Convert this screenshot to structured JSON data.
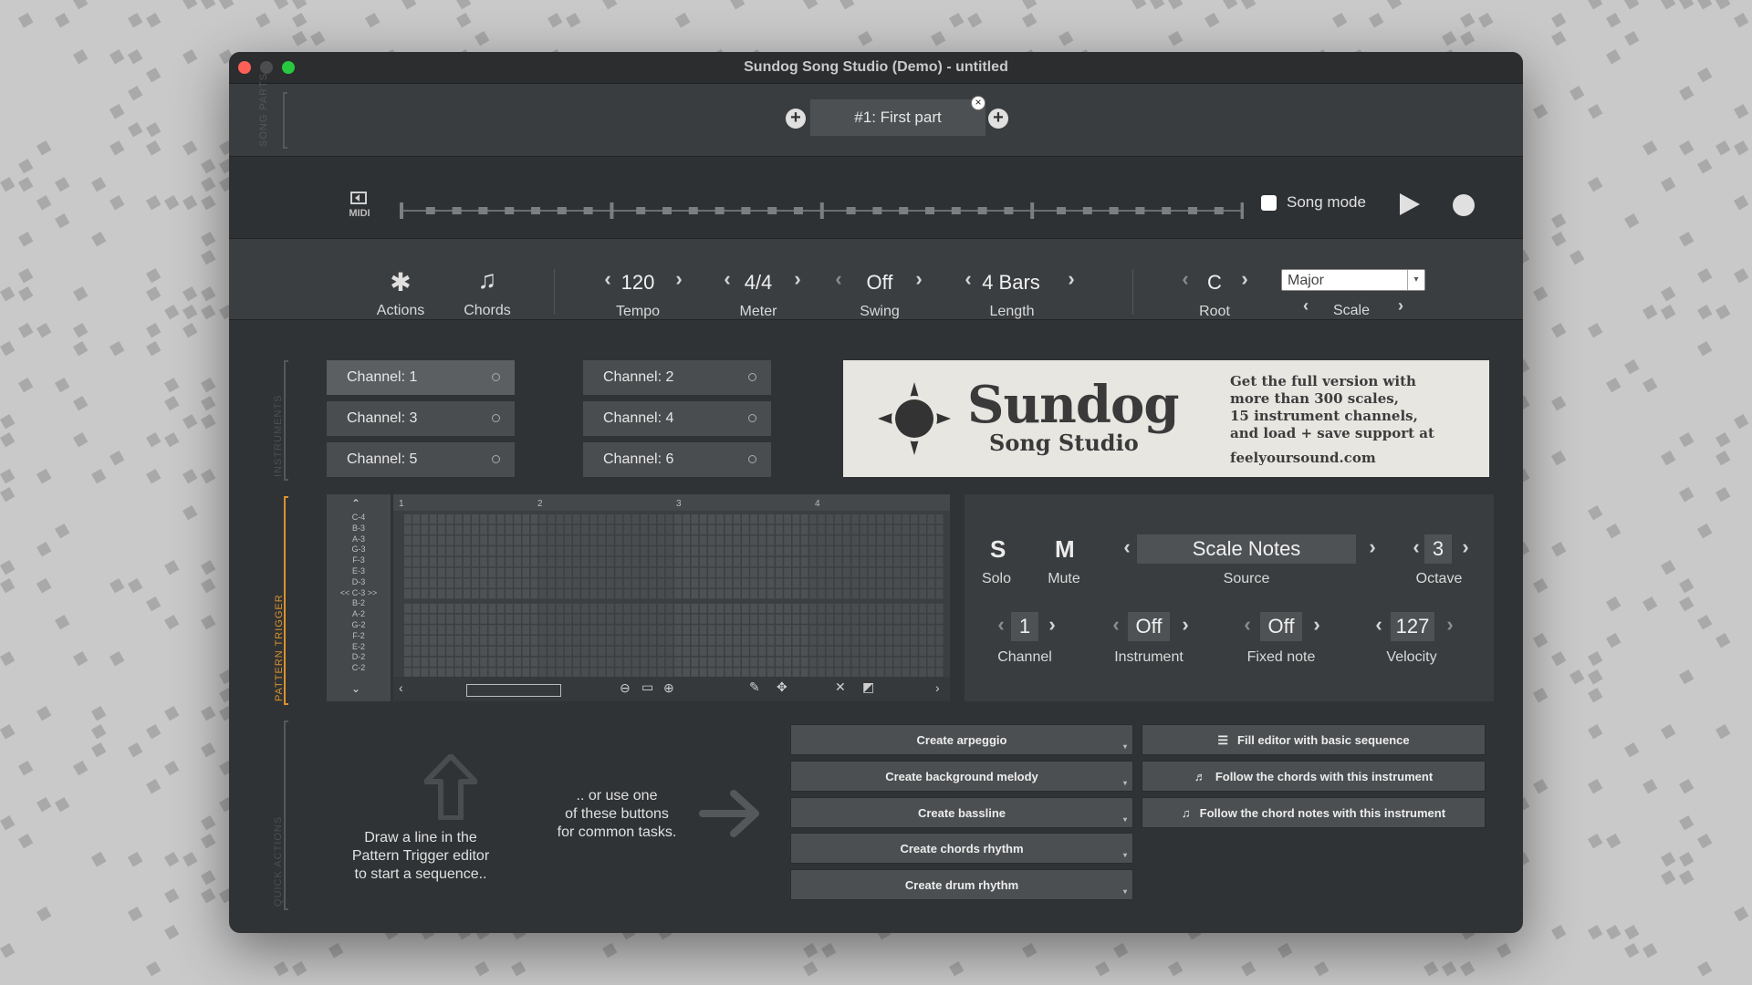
{
  "window": {
    "title": "Sundog Song Studio (Demo) - untitled"
  },
  "song_parts": {
    "section_label": "SONG PARTS",
    "tabs": [
      {
        "label": "#1: First part"
      }
    ]
  },
  "transport": {
    "midi_label": "MIDI",
    "song_mode_label": "Song mode",
    "song_mode_checked": false
  },
  "toolbar": {
    "actions_label": "Actions",
    "chords_label": "Chords",
    "tempo": {
      "value": "120",
      "label": "Tempo"
    },
    "meter": {
      "value": "4/4",
      "label": "Meter"
    },
    "swing": {
      "value": "Off",
      "label": "Swing"
    },
    "length": {
      "value": "4 Bars",
      "label": "Length"
    },
    "root": {
      "value": "C",
      "label": "Root"
    },
    "scale": {
      "selected": "Major",
      "label": "Scale"
    }
  },
  "instruments": {
    "section_label": "INSTRUMENTS",
    "channels": [
      {
        "label": "Channel: 1",
        "active": true
      },
      {
        "label": "Channel: 2",
        "active": false
      },
      {
        "label": "Channel: 3",
        "active": false
      },
      {
        "label": "Channel: 4",
        "active": false
      },
      {
        "label": "Channel: 5",
        "active": false
      },
      {
        "label": "Channel: 6",
        "active": false
      }
    ]
  },
  "ad": {
    "brand": "Sundog",
    "subbrand": "Song Studio",
    "text_lines": [
      "Get the full version with",
      "more than 300 scales,",
      "15 instrument channels,",
      "and load + save support at"
    ],
    "url": "feelyoursound.com"
  },
  "pattern_trigger": {
    "section_label": "PATTERN TRIGGER",
    "note_labels": [
      "C-4",
      "B-3",
      "A-3",
      "G-3",
      "F-3",
      "E-3",
      "D-3",
      "<< C-3 >>",
      "B-2",
      "A-2",
      "G-2",
      "F-2",
      "E-2",
      "D-2",
      "C-2"
    ],
    "bar_numbers": [
      "1",
      "2",
      "3",
      "4"
    ]
  },
  "track": {
    "solo": {
      "letter": "S",
      "label": "Solo"
    },
    "mute": {
      "letter": "M",
      "label": "Mute"
    },
    "source": {
      "value": "Scale Notes",
      "label": "Source"
    },
    "octave": {
      "value": "3",
      "label": "Octave"
    },
    "channel": {
      "value": "1",
      "label": "Channel"
    },
    "instrument": {
      "value": "Off",
      "label": "Instrument"
    },
    "fixed_note": {
      "value": "Off",
      "label": "Fixed note"
    },
    "velocity": {
      "value": "127",
      "label": "Velocity"
    }
  },
  "quick_actions": {
    "section_label": "QUICK ACTIONS",
    "hint_left": [
      "Draw a line in the",
      "Pattern Trigger editor",
      "to start a sequence.."
    ],
    "hint_middle": [
      ".. or use one",
      "of these buttons",
      "for common tasks."
    ],
    "create_buttons": [
      "Create arpeggio",
      "Create background melody",
      "Create bassline",
      "Create chords rhythm",
      "Create drum rhythm"
    ],
    "fill_buttons": [
      "Fill editor with basic sequence",
      "Follow the chords with this instrument",
      "Follow the chord notes with this instrument"
    ]
  },
  "colors": {
    "window_bg": "#303335",
    "panel_bg": "#3b3e40",
    "accent_orange": "#d9922e",
    "desktop_bg": "#c9c9c9"
  }
}
